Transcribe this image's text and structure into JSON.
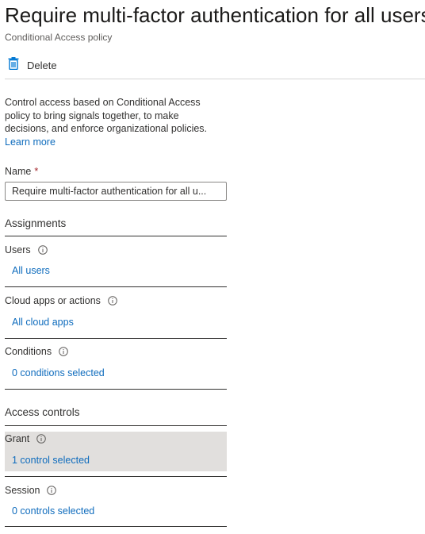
{
  "header": {
    "title": "Require multi-factor authentication for all users",
    "subtitle": "Conditional Access policy"
  },
  "toolbar": {
    "delete_label": "Delete",
    "delete_icon": "trash-icon"
  },
  "description": {
    "text": "Control access based on Conditional Access policy to bring signals together, to make decisions, and enforce organizational policies.",
    "learn_more": "Learn more"
  },
  "name_field": {
    "label": "Name",
    "required_marker": "*",
    "value": "Require multi-factor authentication for all u..."
  },
  "assignments": {
    "heading": "Assignments",
    "users": {
      "label": "Users",
      "value": "All users"
    },
    "cloud_apps": {
      "label": "Cloud apps or actions",
      "value": "All cloud apps"
    },
    "conditions": {
      "label": "Conditions",
      "value": "0 conditions selected"
    }
  },
  "access_controls": {
    "heading": "Access controls",
    "grant": {
      "label": "Grant",
      "value": "1 control selected"
    },
    "session": {
      "label": "Session",
      "value": "0 controls selected"
    }
  },
  "colors": {
    "link": "#0f6cbd",
    "required": "#a4262c",
    "selected_row": "#e1dfdd",
    "icon_blue": "#0078d4"
  }
}
